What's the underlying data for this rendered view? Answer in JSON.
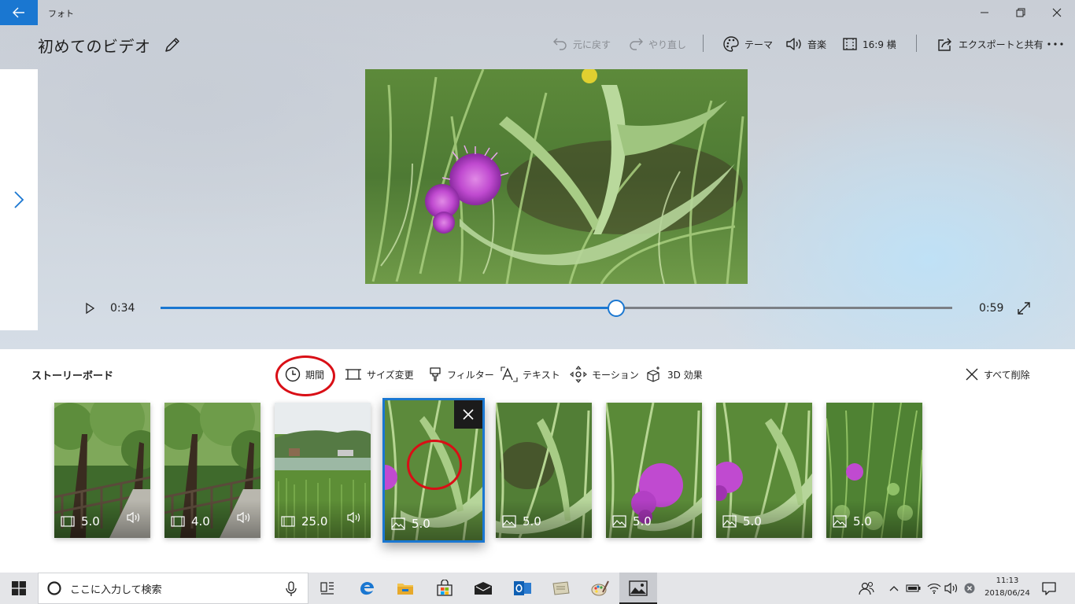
{
  "app": {
    "title": "フォト"
  },
  "project": {
    "title": "初めてのビデオ"
  },
  "commands": {
    "undo": "元に戻す",
    "redo": "やり直し",
    "theme": "テーマ",
    "music": "音楽",
    "aspect": "16:9 横",
    "export": "エクスポートと共有"
  },
  "playback": {
    "current": "0:34",
    "total": "0:59",
    "progress": 0.576
  },
  "storyboard": {
    "title": "ストーリーボード",
    "tools": {
      "duration": "期間",
      "resize": "サイズ変更",
      "filter": "フィルター",
      "text": "テキスト",
      "motion": "モーション",
      "effects3d": "3D 効果",
      "delete_all": "すべて削除"
    },
    "clips": [
      {
        "duration": "5.0",
        "kind": "video",
        "audio": true,
        "scene": "forest path"
      },
      {
        "duration": "4.0",
        "kind": "video",
        "audio": true,
        "scene": "forest path"
      },
      {
        "duration": "25.0",
        "kind": "video",
        "audio": true,
        "scene": "rice field"
      },
      {
        "duration": "5.0",
        "kind": "photo",
        "audio": false,
        "scene": "thistle",
        "selected": true
      },
      {
        "duration": "5.0",
        "kind": "photo",
        "audio": false,
        "scene": "thistle"
      },
      {
        "duration": "5.0",
        "kind": "photo",
        "audio": false,
        "scene": "thistle"
      },
      {
        "duration": "5.0",
        "kind": "photo",
        "audio": false,
        "scene": "thistle"
      },
      {
        "duration": "5.0",
        "kind": "photo",
        "audio": false,
        "scene": "thistle"
      }
    ]
  },
  "taskbar": {
    "search_placeholder": "ここに入力して検索",
    "time": "11:13",
    "date": "2018/06/24"
  },
  "colors": {
    "accent": "#1a77d1",
    "highlight_ring": "#d90f16",
    "thistle": "#c04ad0"
  }
}
